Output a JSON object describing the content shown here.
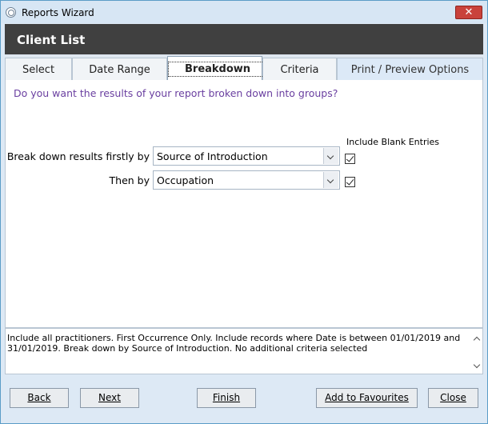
{
  "window": {
    "title": "Reports Wizard",
    "close_glyph": "✕"
  },
  "header": {
    "title": "Client List"
  },
  "tabs": [
    {
      "label": "Select"
    },
    {
      "label": "Date Range"
    },
    {
      "label": "Breakdown"
    },
    {
      "label": "Criteria"
    },
    {
      "label": "Print / Preview Options"
    }
  ],
  "breakdown": {
    "question": "Do you want the results of your report broken down into groups?",
    "include_blank_label": "Include Blank Entries",
    "first": {
      "label": "Break down results firstly by",
      "value": "Source of Introduction",
      "include_blank": true
    },
    "then": {
      "label": "Then by",
      "value": "Occupation",
      "include_blank": true
    }
  },
  "summary": {
    "text": "Include all practitioners. First Occurrence Only. Include records where Date is between 01/01/2019 and 31/01/2019. Break down by Source of Introduction. No additional criteria selected"
  },
  "buttons": {
    "back": "Back",
    "next": "Next",
    "finish": "Finish",
    "add_favourites": "Add to Favourites",
    "close": "Close"
  }
}
